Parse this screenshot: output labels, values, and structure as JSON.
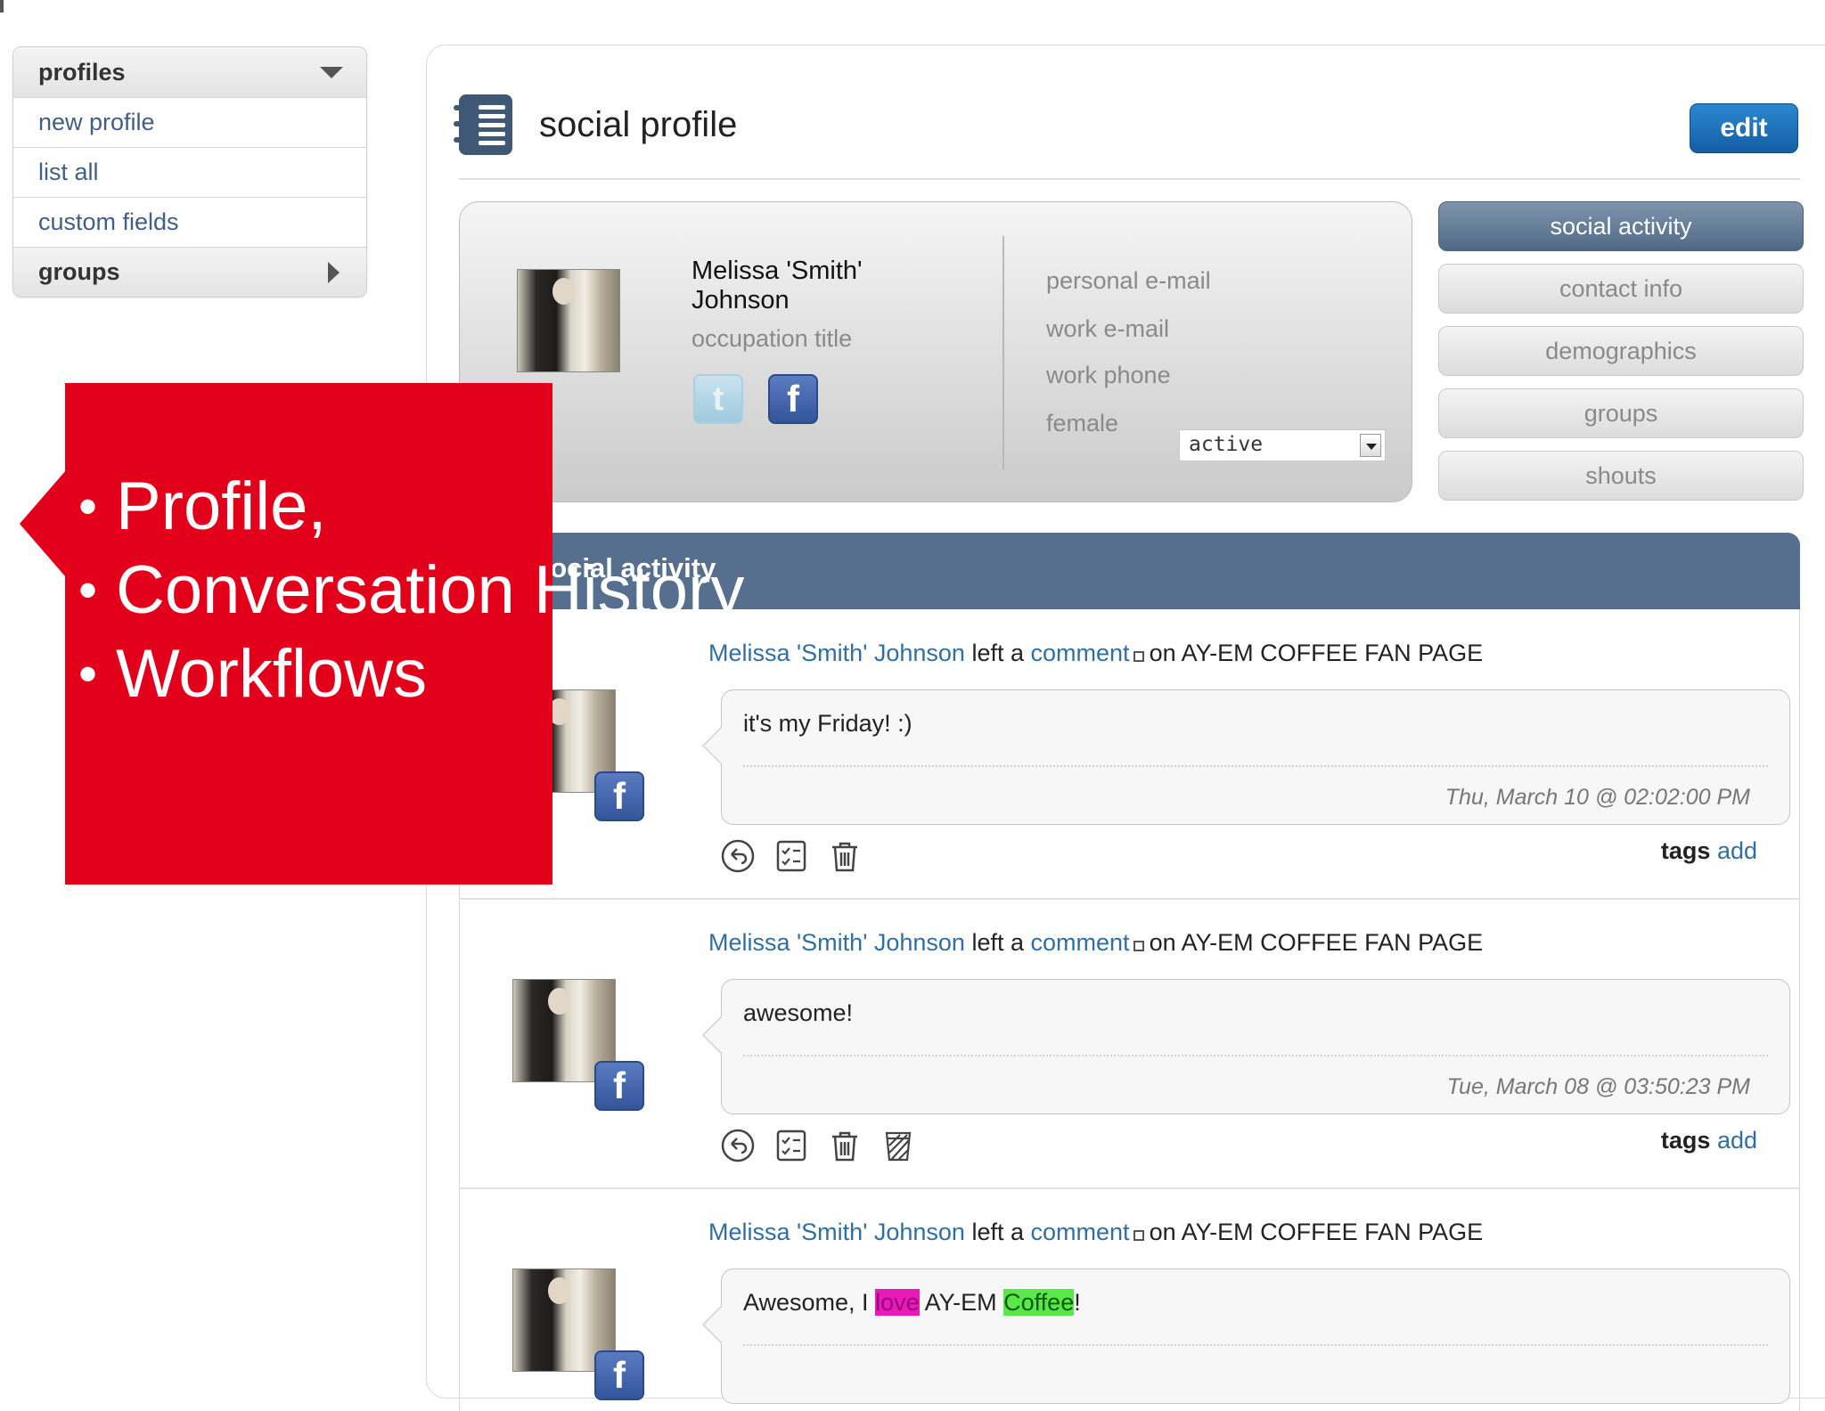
{
  "sidebar": {
    "profiles_label": "profiles",
    "new_profile_label": "new profile",
    "list_all_label": "list all",
    "custom_fields_label": "custom fields",
    "groups_label": "groups"
  },
  "header": {
    "title": "social profile",
    "edit_label": "edit"
  },
  "profile": {
    "name": "Melissa 'Smith' Johnson",
    "occupation": "occupation title",
    "personal_email": "personal e-mail",
    "work_email": "work e-mail",
    "work_phone": "work phone",
    "gender": "female",
    "status": "active"
  },
  "tabs": {
    "social_activity": "social activity",
    "contact_info": "contact info",
    "demographics": "demographics",
    "groups": "groups",
    "shouts": "shouts"
  },
  "activity": {
    "title": "social activity",
    "items": [
      {
        "author": "Melissa 'Smith' Johnson",
        "left_a": "left a",
        "comment": "comment",
        "on_page": "on AY-EM COFFEE FAN PAGE",
        "message": "it's my Friday! :)",
        "timestamp": "Thu, March 10 @ 02:02:00 PM",
        "tags_label": "tags",
        "add_label": "add"
      },
      {
        "author": "Melissa 'Smith' Johnson",
        "left_a": "left a",
        "comment": "comment",
        "on_page": "on AY-EM COFFEE FAN PAGE",
        "message": "awesome!",
        "timestamp": "Tue, March 08 @ 03:50:23 PM",
        "tags_label": "tags",
        "add_label": "add"
      },
      {
        "author": "Melissa 'Smith' Johnson",
        "left_a": "left a",
        "comment": "comment",
        "on_page": "on AY-EM COFFEE FAN PAGE",
        "message_pre": "Awesome, I ",
        "message_hl1": "love",
        "message_mid": " AY-EM ",
        "message_hl2": "Coffee",
        "message_post": "!"
      }
    ]
  },
  "callout": {
    "bullets": [
      "Profile,",
      "Conversation History",
      "Workflows"
    ]
  },
  "colors": {
    "callout_red": "#e2001a",
    "link_blue": "#2f6fa6",
    "activity_header": "#566f8f",
    "edit_button": "#1d6fba"
  }
}
